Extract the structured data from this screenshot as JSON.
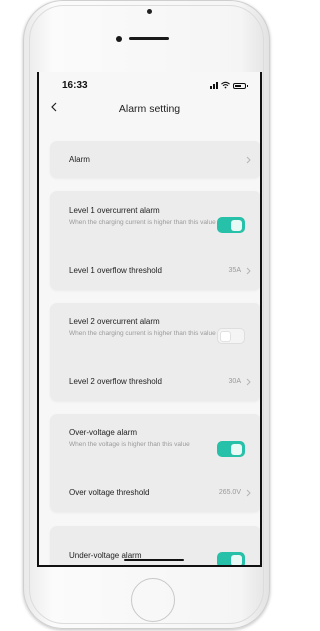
{
  "status": {
    "time": "16:33"
  },
  "nav": {
    "title": "Alarm setting"
  },
  "alarm_row": {
    "label": "Alarm"
  },
  "level1": {
    "title": "Level 1 overcurrent alarm",
    "desc": "When the charging current is higher than this value",
    "enabled": true,
    "threshold_label": "Level 1 overflow threshold",
    "threshold_value": "35A"
  },
  "level2": {
    "title": "Level 2 overcurrent alarm",
    "desc": "When the charging current is higher than this value",
    "enabled": false,
    "threshold_label": "Level 2 overflow threshold",
    "threshold_value": "30A"
  },
  "overvoltage": {
    "title": "Over-voltage alarm",
    "desc": "When the voltage is higher than this value",
    "enabled": true,
    "threshold_label": "Over voltage threshold",
    "threshold_value": "265.0V"
  },
  "undervoltage": {
    "title": "Under-voltage alarm",
    "enabled": true
  },
  "colors": {
    "accent": "#27c0a8",
    "card": "#ececec",
    "screen_bg": "#f7f7f7"
  }
}
